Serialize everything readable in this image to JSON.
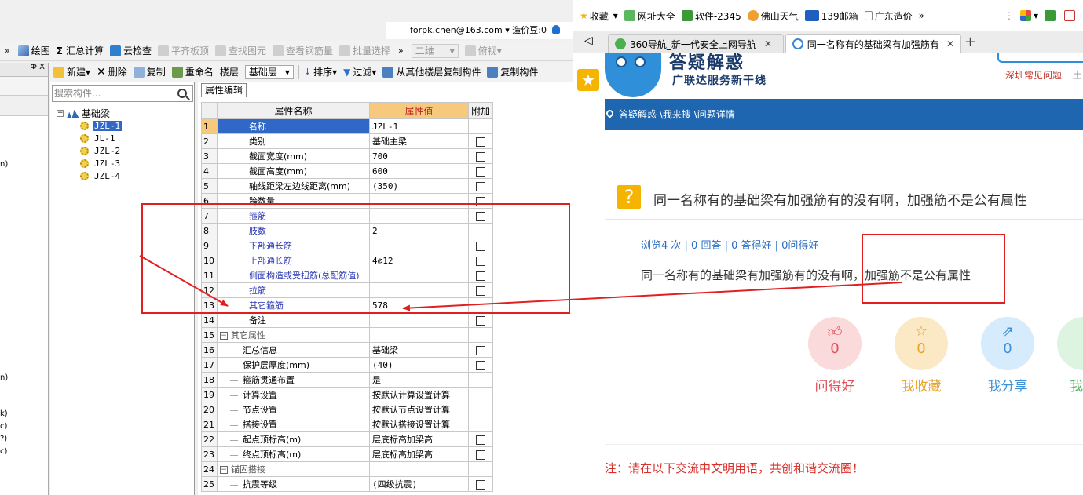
{
  "app": {
    "account": "forpk.chen@163.com",
    "beans": "造价豆:0",
    "toolbar1": {
      "overflow": "»",
      "draw": "绘图",
      "summary": "汇总计算",
      "cloud_check": "云检查",
      "flat_slab": "平齐板顶",
      "find_element": "查找图元",
      "view_rebar": "查看钢筋量",
      "batch_select": "批量选择",
      "overflow2": "»",
      "view_2d": "二维",
      "view_top": "俯视"
    },
    "toolbar2": {
      "new": "新建",
      "delete": "删除",
      "copy": "复制",
      "rename": "重命名",
      "floor_label": "楼层",
      "floor_value": "基础层",
      "sort": "排序",
      "filter": "过滤",
      "copy_from_floor": "从其他楼层复制构件",
      "copy_to": "复制构件"
    },
    "left_panel": {
      "pin": "Ф",
      "close": "X",
      "frag1": "n)",
      "frag2": "n)",
      "frag3": "k)",
      "frag4": "c)",
      "frag5": "?)",
      "frag6": "c)"
    },
    "search": {
      "placeholder": "搜索构件..."
    },
    "tree": {
      "root": "基础梁",
      "items": [
        "JZL-1",
        "JL-1",
        "JZL-2",
        "JZL-3",
        "JZL-4"
      ],
      "selected_index": 0
    },
    "grid": {
      "tab": "属性编辑",
      "headers": [
        "属性名称",
        "属性值",
        "附加"
      ],
      "rows": [
        {
          "n": "1",
          "name": "名称",
          "value": "JZL-1",
          "cb": false
        },
        {
          "n": "2",
          "name": "类别",
          "value": "基础主梁",
          "cb": true
        },
        {
          "n": "3",
          "name": "截面宽度(mm)",
          "value": "700",
          "cb": true
        },
        {
          "n": "4",
          "name": "截面高度(mm)",
          "value": "600",
          "cb": true
        },
        {
          "n": "5",
          "name": "轴线距梁左边线距离(mm)",
          "value": "(350)",
          "cb": true
        },
        {
          "n": "6",
          "name": "跨数量",
          "value": "",
          "cb": true
        },
        {
          "n": "7",
          "name": "箍筋",
          "value": "",
          "cb": true
        },
        {
          "n": "8",
          "name": "肢数",
          "value": "2",
          "cb": false
        },
        {
          "n": "9",
          "name": "下部通长筋",
          "value": "",
          "cb": true
        },
        {
          "n": "10",
          "name": "上部通长筋",
          "value": "4⌀12",
          "cb": true
        },
        {
          "n": "11",
          "name": "侧面构造或受扭筋(总配筋值)",
          "value": "",
          "cb": true
        },
        {
          "n": "12",
          "name": "拉筋",
          "value": "",
          "cb": true
        },
        {
          "n": "13",
          "name": "其它箍筋",
          "value": "578",
          "cb": false
        },
        {
          "n": "14",
          "name": "备注",
          "value": "",
          "cb": true
        },
        {
          "n": "15",
          "name": "其它属性",
          "value": "",
          "cb": false
        },
        {
          "n": "16",
          "name": "汇总信息",
          "value": "基础梁",
          "cb": true
        },
        {
          "n": "17",
          "name": "保护层厚度(mm)",
          "value": "(40)",
          "cb": true
        },
        {
          "n": "18",
          "name": "箍筋贯通布置",
          "value": "是",
          "cb": false
        },
        {
          "n": "19",
          "name": "计算设置",
          "value": "按默认计算设置计算",
          "cb": false
        },
        {
          "n": "20",
          "name": "节点设置",
          "value": "按默认节点设置计算",
          "cb": false
        },
        {
          "n": "21",
          "name": "搭接设置",
          "value": "按默认搭接设置计算",
          "cb": false
        },
        {
          "n": "22",
          "name": "起点顶标高(m)",
          "value": "层底标高加梁高",
          "cb": true
        },
        {
          "n": "23",
          "name": "终点顶标高(m)",
          "value": "层底标高加梁高",
          "cb": true
        },
        {
          "n": "24",
          "name": "锚固搭接",
          "value": "",
          "cb": false
        },
        {
          "n": "25",
          "name": "抗震等级",
          "value": "(四级抗震)",
          "cb": true
        }
      ]
    }
  },
  "browser": {
    "bookmarks": [
      "收藏",
      "网址大全",
      "软件-2345",
      "佛山天气",
      "139邮箱",
      "广东造价"
    ],
    "bookmark_overflow": "»",
    "tabs": [
      {
        "title": "360导航_新一代安全上网导航",
        "active": false
      },
      {
        "title": "同一名称有的基础梁有加强筋有的",
        "active": true
      }
    ],
    "logo_title": "答疑解惑",
    "logo_sub": "广联达服务新干线",
    "top_link": "深圳常见问题",
    "top_link_cut": "土",
    "breadcrumb": "答疑解惑 \\我来搜 \\问题详情",
    "question_title": "同一名称有的基础梁有加强筋有的没有啊，加强筋不是公有属性",
    "stats": "浏览4 次 | 0 回答 | 0 答得好 | 0问得好",
    "question_body": "同一名称有的基础梁有加强筋有的没有啊，加强筋不是公有属性",
    "actions": [
      {
        "count": "0",
        "label": "问得好",
        "color": "#f7c7c7",
        "fg": "#e0505a"
      },
      {
        "count": "0",
        "label": "我收藏",
        "color": "#fbe3b8",
        "fg": "#e8a42a"
      },
      {
        "count": "0",
        "label": "我分享",
        "color": "#cfe7fb",
        "fg": "#3d8fd8"
      },
      {
        "count": "",
        "label": "我",
        "color": "#d4f3d9",
        "fg": "#4cb45c"
      }
    ],
    "note": "注：请在以下交流中文明用语，共创和谐交流圈！"
  },
  "colors": {
    "annotation": "#e02020",
    "nav": "#1e66b0",
    "accent": "#f5b400"
  }
}
